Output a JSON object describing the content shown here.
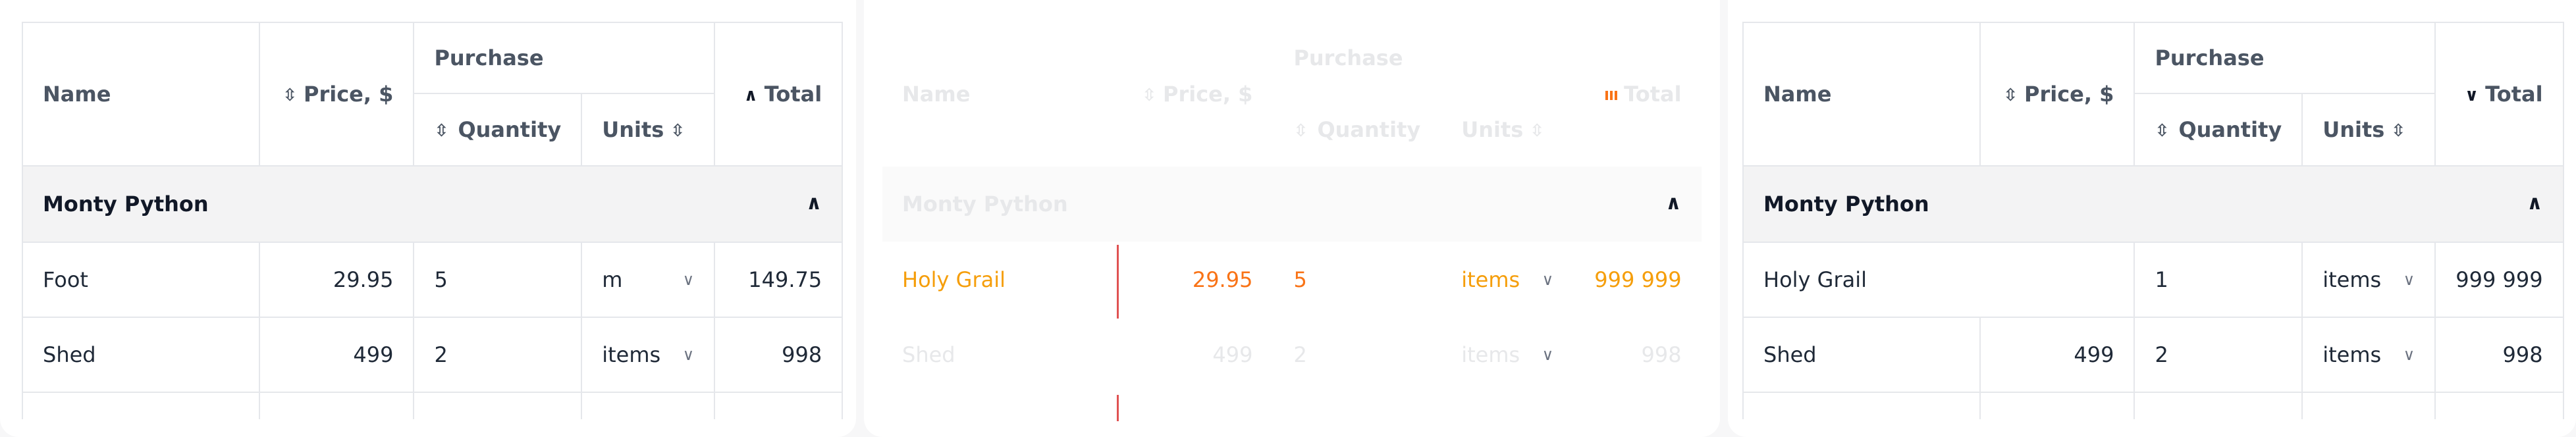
{
  "columns": {
    "name": "Name",
    "price": "Price, $",
    "purchase": "Purchase",
    "quantity": "Quantity",
    "units": "Units",
    "total": "Total"
  },
  "group": "Monty Python",
  "tables": [
    {
      "rows": [
        {
          "name": "Foot",
          "price": "29.95",
          "quantity": "5",
          "units": "m",
          "total": "149.75"
        },
        {
          "name": "Shed",
          "price": "499",
          "quantity": "2",
          "units": "items",
          "total": "998"
        }
      ]
    },
    {
      "rows": [
        {
          "name": "Holy Grail",
          "price": "29.95",
          "quantity": "5",
          "units": "items",
          "total": "999 999"
        },
        {
          "name": "Shed",
          "price": "499",
          "quantity": "2",
          "units": "items",
          "total": "998"
        }
      ]
    },
    {
      "rows": [
        {
          "name": "Holy Grail",
          "price": "",
          "quantity": "1",
          "units": "items",
          "total": "999 999"
        },
        {
          "name": "Shed",
          "price": "499",
          "quantity": "2",
          "units": "items",
          "total": "998"
        }
      ]
    }
  ]
}
